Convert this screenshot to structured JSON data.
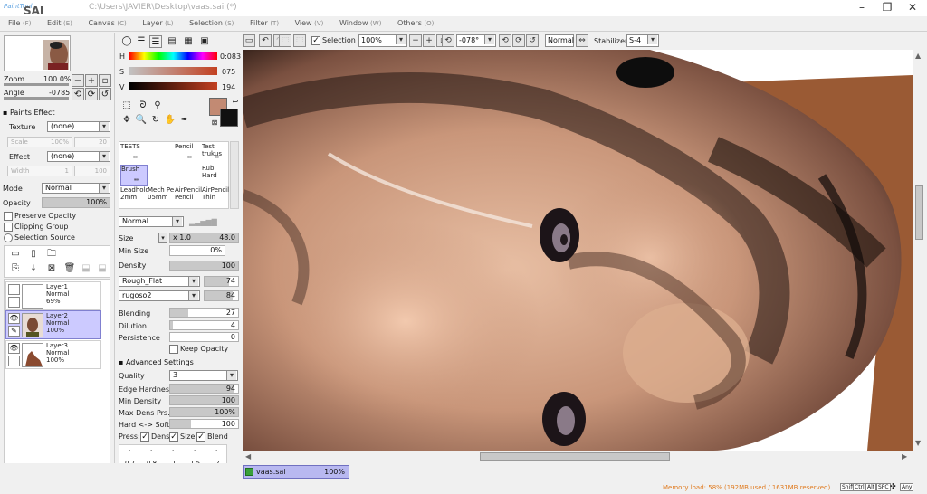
{
  "window": {
    "app_logo": "PaintTool SAI",
    "title": "C:\\Users\\JAVIER\\Desktop\\vaas.sai (*)",
    "controls": [
      "minimize-icon",
      "maximize-icon",
      "close-icon"
    ]
  },
  "menu": [
    {
      "label": "File",
      "key": "(F)"
    },
    {
      "label": "Edit",
      "key": "(E)"
    },
    {
      "label": "Canvas",
      "key": "(C)"
    },
    {
      "label": "Layer",
      "key": "(L)"
    },
    {
      "label": "Selection",
      "key": "(S)"
    },
    {
      "label": "Filter",
      "key": "(T)"
    },
    {
      "label": "View",
      "key": "(V)"
    },
    {
      "label": "Window",
      "key": "(W)"
    },
    {
      "label": "Others",
      "key": "(O)"
    }
  ],
  "toolbar": {
    "selection_label": "Selection",
    "selection_checked": true,
    "zoom": "100%",
    "angle": "-078°",
    "blend": "Normal",
    "stabilizer_label": "Stabilizer",
    "stabilizer": "S-4"
  },
  "navigator": {
    "zoom_label": "Zoom",
    "zoom_value": "100.0%",
    "angle_label": "Angle",
    "angle_value": "-0785"
  },
  "paints_effect": {
    "header": "Paints Effect",
    "texture_label": "Texture",
    "texture_value": "(none)",
    "scale_label": "Scale",
    "scale_value": "100%",
    "scale_num": "20",
    "effect_label": "Effect",
    "effect_value": "(none)",
    "width_label": "Width",
    "width_value": "1",
    "width_num": "100"
  },
  "layer_props": {
    "mode_label": "Mode",
    "mode_value": "Normal",
    "opacity_label": "Opacity",
    "opacity_value": "100%",
    "opacity_fraction": 1.0,
    "preserve_opacity": "Preserve Opacity",
    "clipping_group": "Clipping Group",
    "selection_source": "Selection Source"
  },
  "layers": [
    {
      "name": "Layer1",
      "mode": "Normal",
      "opacity": "69%",
      "selected": false,
      "visible": false
    },
    {
      "name": "Layer2",
      "mode": "Normal",
      "opacity": "100%",
      "selected": true,
      "visible": true
    },
    {
      "name": "Layer3",
      "mode": "Normal",
      "opacity": "100%",
      "selected": false,
      "visible": true
    }
  ],
  "color": {
    "h_label": "H",
    "h_value": "0:083",
    "s_label": "S",
    "s_value": "075",
    "v_label": "V",
    "v_value": "194",
    "foreground": "#c28a73",
    "background": "#111111"
  },
  "tools": [
    {
      "name": "TESTS",
      "sub": ""
    },
    {
      "name": "",
      "sub": ""
    },
    {
      "name": "Pencil",
      "sub": ""
    },
    {
      "name": "Test",
      "sub": "trukus"
    },
    {
      "name": "Brush",
      "sub": "",
      "selected": true
    },
    {
      "name": "",
      "sub": ""
    },
    {
      "name": "",
      "sub": ""
    },
    {
      "name": "Rub",
      "sub": "Hard"
    },
    {
      "name": "Leadhold",
      "sub": "2mm"
    },
    {
      "name": "Mech Pe",
      "sub": "05mm"
    },
    {
      "name": "AirPencil",
      "sub": "Pencil"
    },
    {
      "name": "AirPencil",
      "sub": "Thin"
    }
  ],
  "brush": {
    "blend": "Normal",
    "size_label": "Size",
    "size_mult": "x 1.0",
    "size_value": "48.0",
    "minsize_label": "Min Size",
    "minsize_value": "0%",
    "density_label": "Density",
    "density_value": "100",
    "shape": "Rough_Flat",
    "shape_value": "74",
    "texture": "rugoso2",
    "texture_value": "84",
    "blending_label": "Blending",
    "blending_value": "27",
    "dilution_label": "Dilution",
    "dilution_value": "4",
    "persistence_label": "Persistence",
    "persistence_value": "0",
    "keep_opacity": "Keep Opacity",
    "advanced_header": "Advanced Settings",
    "quality_label": "Quality",
    "quality_value": "3",
    "edge_label": "Edge Hardness",
    "edge_value": "94",
    "mindens_label": "Min Density",
    "mindens_value": "100",
    "maxdens_label": "Max Dens Prs.",
    "maxdens_value": "100%",
    "hardsoft_label": "Hard <-> Soft",
    "hardsoft_value": "100",
    "press_label": "Press:",
    "press_dens": "Dens",
    "press_size": "Size",
    "press_blend": "Blend",
    "presets": [
      "0.7",
      "0.8",
      "1",
      "1.5",
      "2"
    ]
  },
  "document_tab": {
    "name": "vaas.sai",
    "zoom": "100%"
  },
  "status": {
    "memory": "Memory load: 58% (192MB used / 1631MB reserved)",
    "keys": [
      "Shift",
      "Ctrl",
      "Alt",
      "SPC",
      "Any"
    ]
  }
}
